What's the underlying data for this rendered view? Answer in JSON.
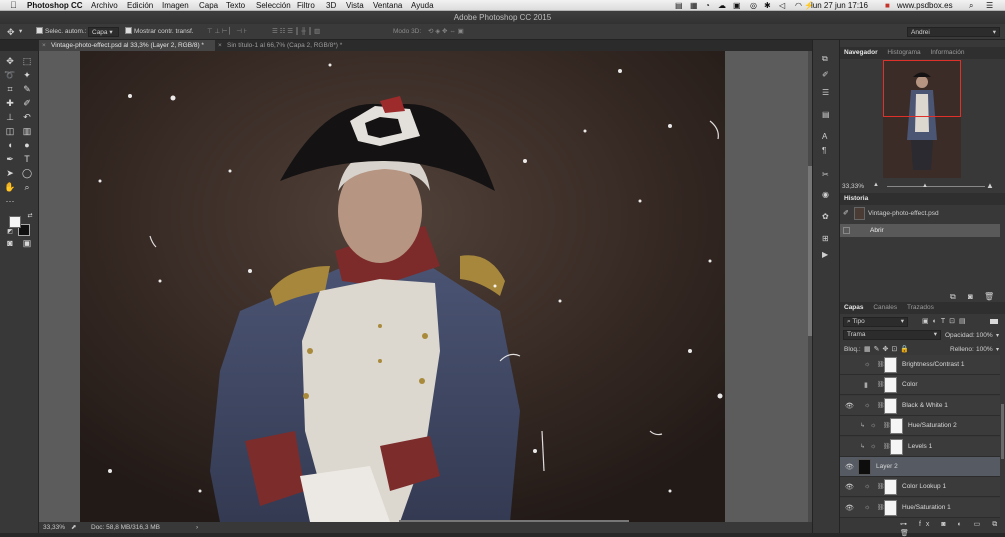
{
  "menubar": {
    "app": "Photoshop CC",
    "items": [
      "Archivo",
      "Edición",
      "Imagen",
      "Capa",
      "Texto",
      "Selección",
      "Filtro",
      "3D",
      "Vista",
      "Ventana",
      "Ayuda"
    ],
    "battery": "⚡",
    "clock": "lun 27 jun  17:16",
    "site": "www.psdbox.es"
  },
  "window_title": "Adobe Photoshop CC 2015",
  "options": {
    "auto_select": "Selec. autom.:",
    "target": "Capa",
    "show_transform": "Mostrar contr. transf.",
    "mode3d": "Modo 3D:",
    "workspace": "Andrei"
  },
  "tabs": [
    {
      "label": "Vintage-photo-effect.psd al 33,3% (Layer 2, RGB/8) *",
      "active": true
    },
    {
      "label": "Sin título-1 al 66,7% (Capa 2, RGB/8*) *",
      "active": false
    }
  ],
  "status": {
    "zoom": "33,33%",
    "doc": "Doc: 58,8 MB/316,3 MB"
  },
  "navigator": {
    "tabs": [
      "Navegador",
      "Histograma",
      "Información"
    ],
    "zoom": "33,33%"
  },
  "history": {
    "title": "Historia",
    "snapshot": "Vintage-photo-effect.psd",
    "steps": [
      "Abrir"
    ]
  },
  "layers_panel": {
    "tabs": [
      "Capas",
      "Canales",
      "Trazados"
    ],
    "filter": "Tipo",
    "blend": "Trama",
    "opacity_label": "Opacidad:",
    "opacity": "100%",
    "lock_label": "Bloq.:",
    "fill_label": "Relleno:",
    "fill": "100%",
    "layers": [
      {
        "name": "Brightness/Contrast 1",
        "visible": false,
        "clipped": false,
        "kind": "adjust"
      },
      {
        "name": "Color",
        "visible": false,
        "clipped": false,
        "kind": "fill"
      },
      {
        "name": "Black & White 1",
        "visible": true,
        "clipped": false,
        "kind": "adjust"
      },
      {
        "name": "Hue/Saturation 2",
        "visible": false,
        "clipped": true,
        "kind": "adjust"
      },
      {
        "name": "Levels 1",
        "visible": false,
        "clipped": true,
        "kind": "adjust"
      },
      {
        "name": "Layer 2",
        "visible": true,
        "clipped": false,
        "kind": "pixel",
        "selected": true
      },
      {
        "name": "Color Lookup 1",
        "visible": true,
        "clipped": false,
        "kind": "adjust"
      },
      {
        "name": "Hue/Saturation 1",
        "visible": true,
        "clipped": false,
        "kind": "adjust"
      }
    ]
  },
  "colors": {
    "foreground": "#f4f4f4",
    "background": "#111111",
    "nav_frame": "#e0302a"
  }
}
